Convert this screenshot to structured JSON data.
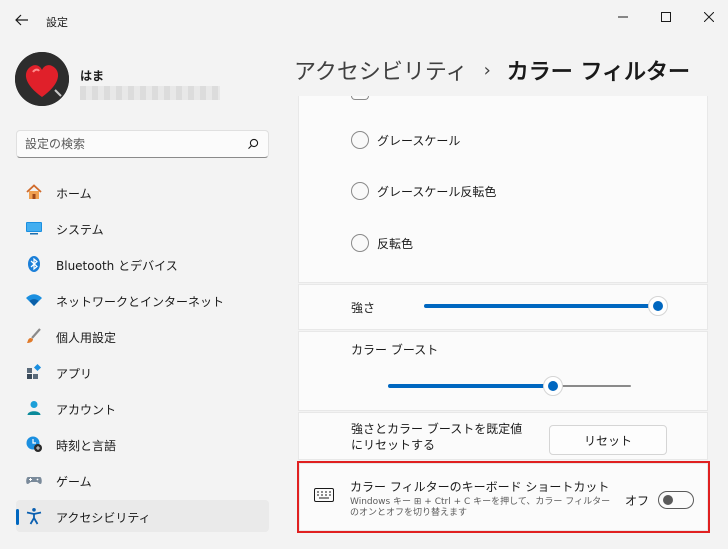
{
  "window": {
    "title": "設定"
  },
  "user": {
    "name": "はま"
  },
  "search": {
    "placeholder": "設定の検索"
  },
  "sidebar": {
    "items": [
      {
        "label": "ホーム",
        "icon": "home-icon"
      },
      {
        "label": "システム",
        "icon": "system-icon"
      },
      {
        "label": "Bluetooth とデバイス",
        "icon": "bluetooth-icon"
      },
      {
        "label": "ネットワークとインターネット",
        "icon": "wifi-icon"
      },
      {
        "label": "個人用設定",
        "icon": "brush-icon"
      },
      {
        "label": "アプリ",
        "icon": "apps-icon"
      },
      {
        "label": "アカウント",
        "icon": "account-icon"
      },
      {
        "label": "時刻と言語",
        "icon": "time-language-icon"
      },
      {
        "label": "ゲーム",
        "icon": "gamepad-icon"
      },
      {
        "label": "アクセシビリティ",
        "icon": "accessibility-icon",
        "active": true
      }
    ]
  },
  "breadcrumb": {
    "parent": "アクセシビリティ",
    "separator": "›",
    "current": "カラー フィルター"
  },
  "filters": {
    "options": [
      {
        "label": "グレースケール",
        "selected": false
      },
      {
        "label": "グレースケール反転色",
        "selected": false
      },
      {
        "label": "反転色",
        "selected": false
      }
    ]
  },
  "intensity": {
    "label": "強さ",
    "value_fraction": 1.0
  },
  "boost": {
    "label": "カラー ブースト",
    "value_fraction": 0.67
  },
  "reset": {
    "description": "強さとカラー ブーストを既定値にリセットする",
    "button_label": "リセット"
  },
  "shortcut": {
    "title": "カラー フィルターのキーボード ショートカット",
    "description": "Windows キー ⊞ + Ctrl + C キーを押して、カラー フィルターのオンとオフを切り替えます",
    "state_label": "オフ",
    "enabled": false,
    "icon": "keyboard-icon"
  },
  "colors": {
    "accent": "#0067c0",
    "highlight_border": "#e02020",
    "background": "#f3f3f3",
    "card": "#fbfbfb"
  }
}
